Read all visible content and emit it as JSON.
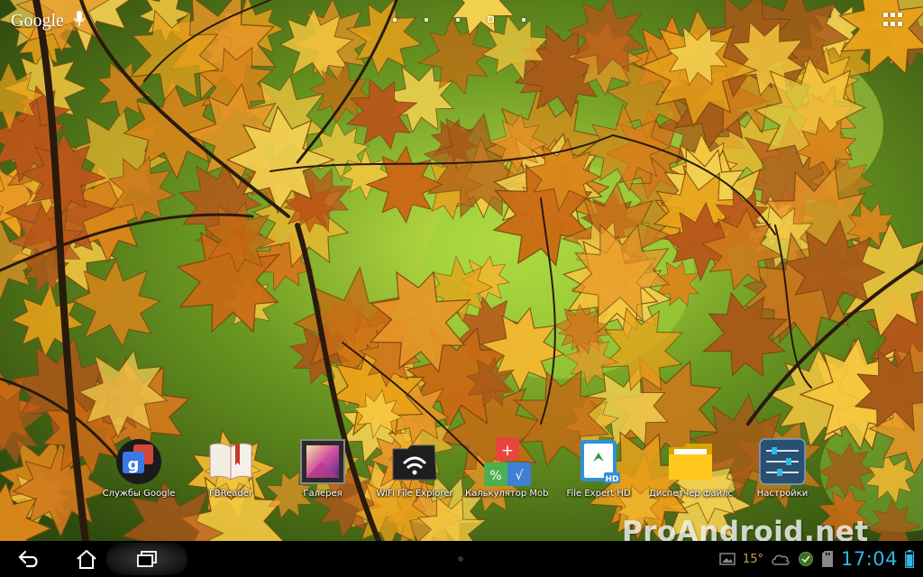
{
  "search_bar": {
    "logo_text": "Google",
    "voice_icon": "microphone-icon"
  },
  "home_pages": {
    "count": 5,
    "active_index": 3
  },
  "apps": [
    {
      "label": "Службы Google",
      "icon": "google-services-icon"
    },
    {
      "label": "FBReader",
      "icon": "book-icon"
    },
    {
      "label": "Галерея",
      "icon": "gallery-icon"
    },
    {
      "label": "WiFi File Explorer",
      "icon": "wifi-folder-icon"
    },
    {
      "label": "Калькулятор Mobi",
      "icon": "calculator-icon"
    },
    {
      "label": "File Expert HD",
      "icon": "file-expert-icon"
    },
    {
      "label": "Диспетчер файлов",
      "icon": "folder-icon"
    },
    {
      "label": "Настройки",
      "icon": "settings-sliders-icon"
    }
  ],
  "status_bar": {
    "temperature": "15°",
    "time": "17:04"
  },
  "watermark": "ProAndroid.net",
  "colors": {
    "clock": "#33b5e5",
    "navbar": "#000000",
    "temperature": "#c9a24a"
  }
}
